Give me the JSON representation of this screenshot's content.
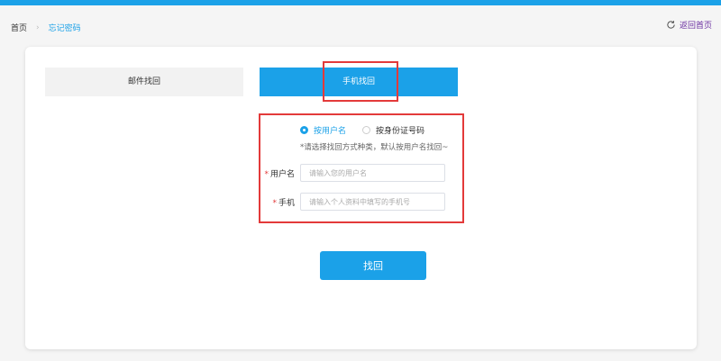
{
  "breadcrumb": {
    "home": "首页",
    "separator": "›",
    "current": "忘记密码"
  },
  "header": {
    "back_label": "返回首页",
    "back_icon": "refresh-icon"
  },
  "tabs": {
    "email": "邮件找回",
    "phone": "手机找回",
    "active": "phone"
  },
  "radio": {
    "username": "按用户名",
    "id_number": "按身份证号码",
    "selected": "username"
  },
  "hint": "*请选择找回方式种类，默认按用户名找回~",
  "fields": {
    "username": {
      "required_mark": "*",
      "label": "用户名",
      "placeholder": "请输入您的用户名",
      "value": ""
    },
    "phone": {
      "required_mark": "*",
      "label": "手机",
      "placeholder": "请输入个人资料中填写的手机号",
      "value": ""
    }
  },
  "submit_label": "找回",
  "colors": {
    "accent": "#1ba1e8",
    "highlight": "#e33a3a",
    "back_link": "#6a2ea0"
  }
}
